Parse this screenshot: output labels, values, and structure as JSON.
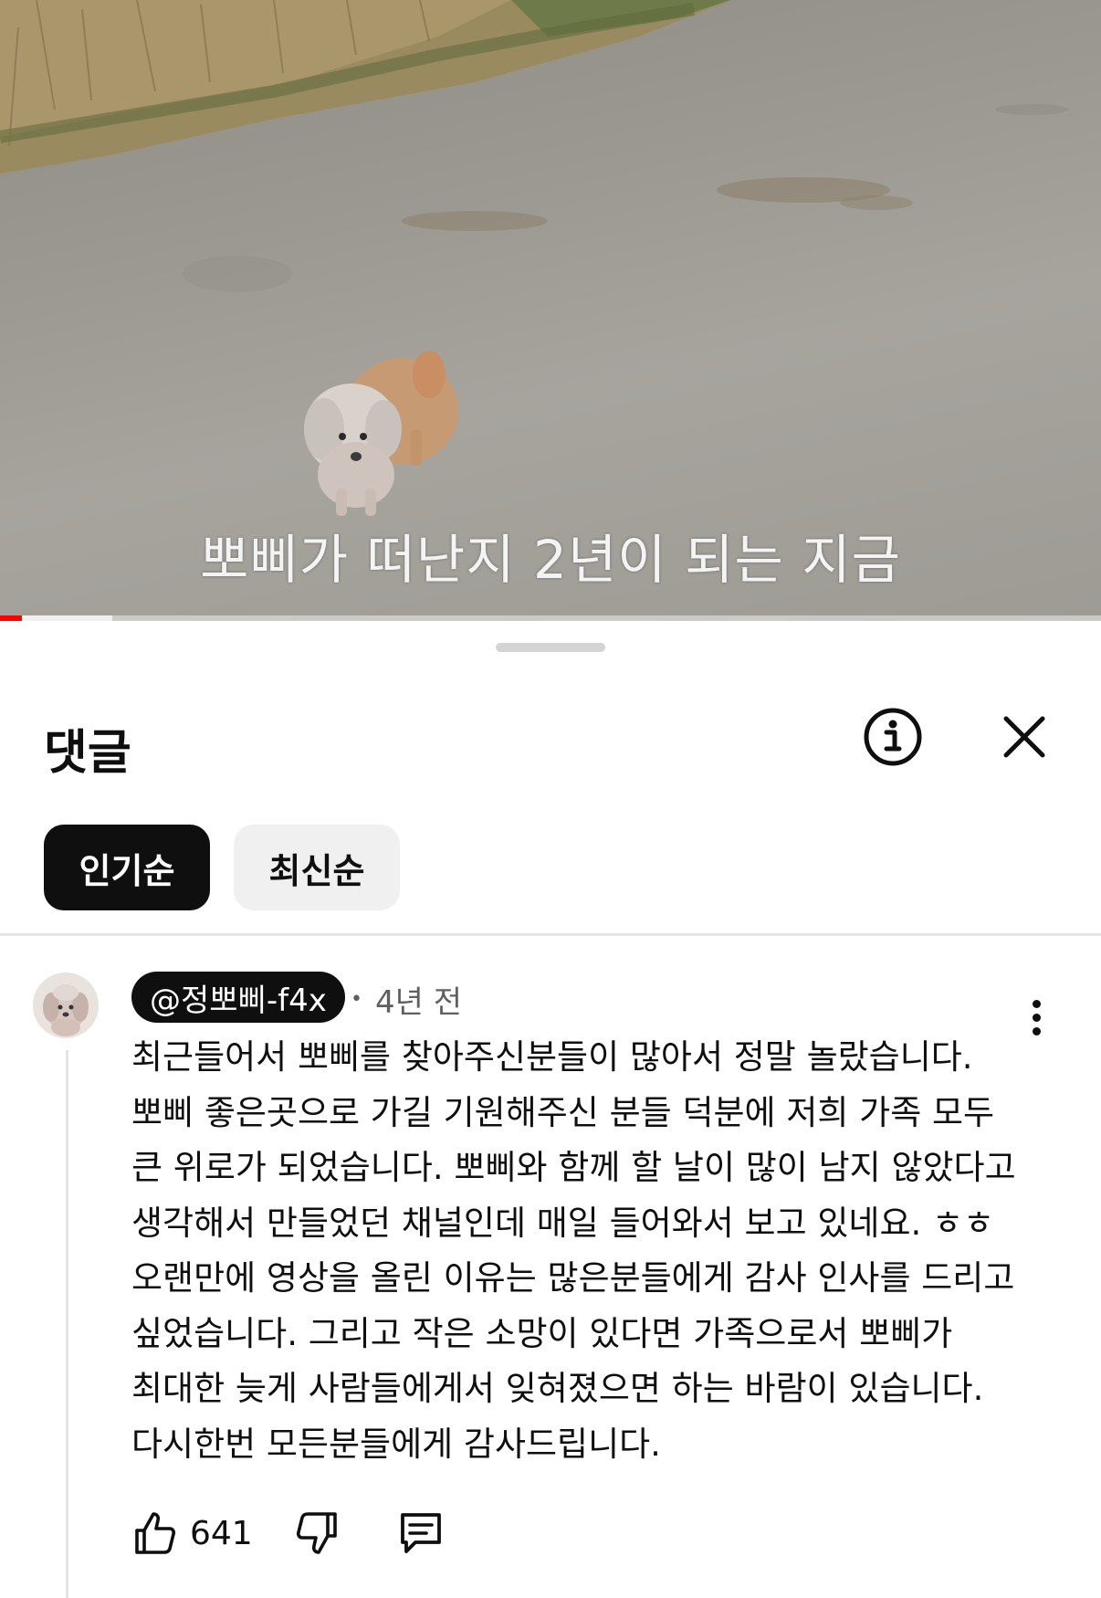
{
  "video": {
    "subtitle": "뽀삐가 떠난지 2년이 되는 지금",
    "progress_played": 0.02,
    "progress_buffered": 0.102
  },
  "comments_panel": {
    "title": "댓글",
    "info_icon": "info-icon",
    "close_icon": "close-icon",
    "sort_chips": [
      {
        "label": "인기순",
        "selected": true
      },
      {
        "label": "최신순",
        "selected": false
      }
    ]
  },
  "comment": {
    "author": "@정뽀삐-f4x",
    "time": "4년 전",
    "separator": "•",
    "text": "최근들어서 뽀삐를 찾아주신분들이 많아서 정말 놀랐습니다.\n뽀삐 좋은곳으로 가길 기원해주신 분들 덕분에 저희 가족 모두 큰 위로가 되었습니다. 뽀삐와 함께 할 날이 많이 남지 않았다고 생각해서 만들었던 채널인데 매일 들어와서 보고 있네요. ㅎㅎ 오랜만에 영상을 올린 이유는 많은분들에게 감사 인사를 드리고 싶었습니다. 그리고 작은 소망이 있다면 가족으로서 뽀삐가 최대한 늦게 사람들에게서 잊혀졌으면 하는 바람이 있습니다. 다시한번 모든분들에게 감사드립니다.",
    "likes": "641",
    "icons": [
      "like-icon",
      "dislike-icon",
      "reply-icon",
      "more-vert-icon"
    ]
  },
  "colors": {
    "accent_red": "#ff0000",
    "chip_active_bg": "#0f0f0f",
    "chip_inactive_bg": "#f0f0f0",
    "secondary_text": "#606060"
  }
}
